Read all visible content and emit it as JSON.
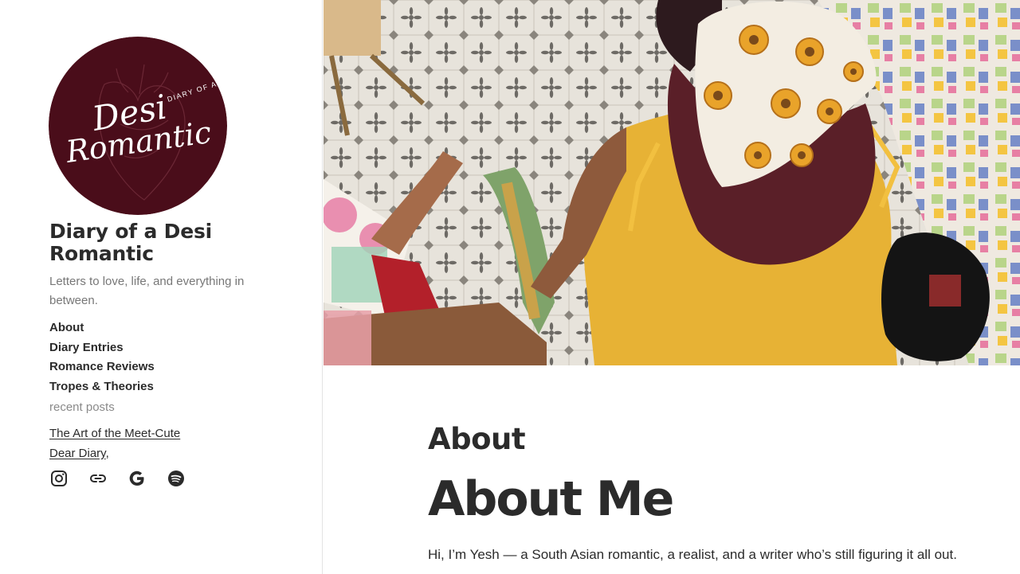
{
  "site": {
    "title": "Diary of a Desi Romantic",
    "tagline": "Letters to love, life, and everything in between.",
    "logo_text": {
      "small": "DIARY OF A",
      "line1": "Desi",
      "line2": "Romantic"
    }
  },
  "nav": {
    "items": [
      {
        "label": "About"
      },
      {
        "label": "Diary Entries"
      },
      {
        "label": "Romance Reviews"
      },
      {
        "label": "Tropes & Theories"
      }
    ]
  },
  "recent": {
    "heading": "recent posts",
    "posts": [
      {
        "label": "The Art of the Meet-Cute"
      },
      {
        "label": "Dear Diary"
      }
    ],
    "separator": ","
  },
  "social": [
    {
      "icon": "instagram-icon"
    },
    {
      "icon": "link-icon"
    },
    {
      "icon": "google-icon"
    },
    {
      "icon": "spotify-icon"
    }
  ],
  "page": {
    "heading": "About",
    "post_title": "About Me",
    "intro": "Hi, I’m Yesh — a South Asian romantic, a realist, and a writer who’s still figuring it all out."
  },
  "colors": {
    "logo_bg": "#4a0d1a",
    "text_dark": "#2b2b2b",
    "text_muted": "#777777",
    "border": "#e4e4e4"
  }
}
